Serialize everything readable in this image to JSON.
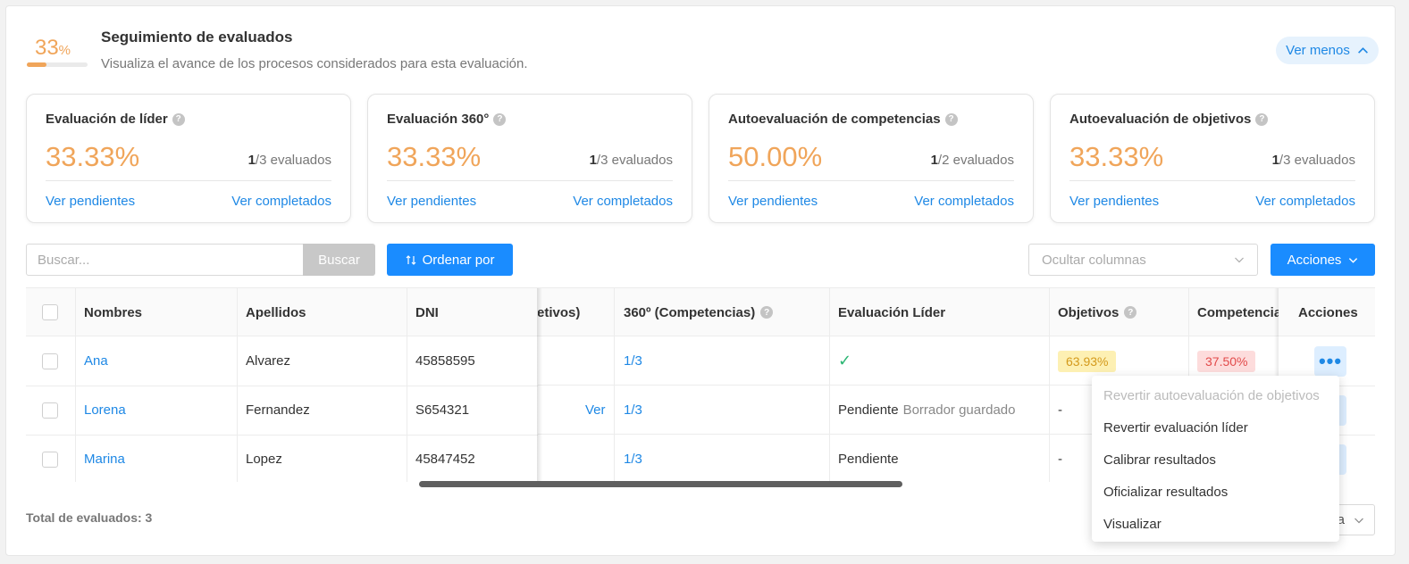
{
  "header": {
    "progress_value": "33",
    "progress_symbol": "%",
    "progress_fraction": 0.33,
    "title": "Seguimiento de evaluados",
    "subtitle": "Visualiza el avance de los procesos considerados para esta evaluación.",
    "toggle_label": "Ver menos"
  },
  "cards": [
    {
      "title": "Evaluación de líder",
      "percent": "33.33%",
      "done": "1",
      "total_text": "/3 evaluados",
      "pending_link": "Ver pendientes",
      "completed_link": "Ver completados"
    },
    {
      "title": "Evaluación 360°",
      "percent": "33.33%",
      "done": "1",
      "total_text": "/3 evaluados",
      "pending_link": "Ver pendientes",
      "completed_link": "Ver completados"
    },
    {
      "title": "Autoevaluación de competencias",
      "percent": "50.00%",
      "done": "1",
      "total_text": "/2 evaluados",
      "pending_link": "Ver pendientes",
      "completed_link": "Ver completados"
    },
    {
      "title": "Autoevaluación de objetivos",
      "percent": "33.33%",
      "done": "1",
      "total_text": "/3 evaluados",
      "pending_link": "Ver pendientes",
      "completed_link": "Ver completados"
    }
  ],
  "toolbar": {
    "search_placeholder": "Buscar...",
    "search_button": "Buscar",
    "order_button": "Ordenar por",
    "hide_columns_placeholder": "Ocultar columnas",
    "actions_button": "Acciones"
  },
  "table": {
    "headers": {
      "nombres": "Nombres",
      "apellidos": "Apellidos",
      "dni": "DNI",
      "objetivos_partial": "etivos)",
      "competencias_360": "360º (Competencias)",
      "evaluacion_lider": "Evaluación Líder",
      "objetivos": "Objetivos",
      "competencias": "Competencias",
      "acciones": "Acciones"
    },
    "rows": [
      {
        "nombre": "Ana",
        "apellido": "Alvarez",
        "dni": "45858595",
        "obj_partial": "",
        "c360": "1/3",
        "lider": "✓",
        "lider_extra": "",
        "objetivos": "63.93%",
        "competencias": "37.50%"
      },
      {
        "nombre": "Lorena",
        "apellido": "Fernandez",
        "dni": "S654321",
        "obj_partial": "Ver",
        "c360": "1/3",
        "lider": "Pendiente",
        "lider_extra": "Borrador guardado",
        "objetivos": "-",
        "competencias": ""
      },
      {
        "nombre": "Marina",
        "apellido": "Lopez",
        "dni": "45847452",
        "obj_partial": "",
        "c360": "1/3",
        "lider": "Pendiente",
        "lider_extra": "",
        "objetivos": "-",
        "competencias": ""
      }
    ]
  },
  "footer": {
    "total": "Total de evaluados: 3",
    "pager_partial": "a"
  },
  "menu": {
    "items": [
      {
        "label": "Revertir autoevaluación de objetivos",
        "disabled": true
      },
      {
        "label": "Revertir evaluación líder",
        "disabled": false
      },
      {
        "label": "Calibrar resultados",
        "disabled": false
      },
      {
        "label": "Oficializar resultados",
        "disabled": false
      },
      {
        "label": "Visualizar",
        "disabled": false
      }
    ]
  },
  "colors": {
    "accent": "#1a8cff",
    "orange": "#f0a55a",
    "link": "#1e88e5",
    "check": "#2bb673"
  }
}
